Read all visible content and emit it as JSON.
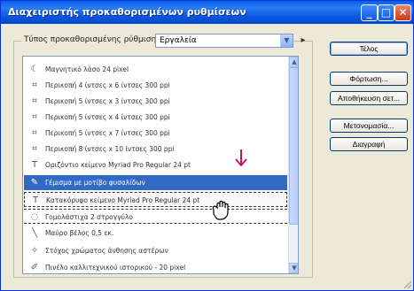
{
  "window": {
    "title": "Διαχειριστής προκαθορισμένων ρυθμίσεων",
    "min_label": "_",
    "max_label": "□",
    "close_label": "✕"
  },
  "preset": {
    "label": "Τύπος προκαθορισμένης ρύθμισης:",
    "selected": "Εργαλεία",
    "menu_icon": "▸"
  },
  "list": {
    "items": [
      {
        "icon": "magnetic-lasso-icon",
        "glyph": "☾",
        "label": "Μαγνητικό λάσο 24 pixel"
      },
      {
        "icon": "crop-icon",
        "glyph": "⌗",
        "label": "Περικοπή 4 ίντσες x 6 ίντσες 300 ppi"
      },
      {
        "icon": "crop-icon",
        "glyph": "⌗",
        "label": "Περικοπή 5 ίντσες x 3 ίντσες 300 ppi"
      },
      {
        "icon": "crop-icon",
        "glyph": "⌗",
        "label": "Περικοπή 5 ίντσες x 4 ίντσες 300 ppi"
      },
      {
        "icon": "crop-icon",
        "glyph": "⌗",
        "label": "Περικοπή 5 ίντσες x 7 ίντσες 300 ppi"
      },
      {
        "icon": "crop-icon",
        "glyph": "⌗",
        "label": "Περικοπή 8 ίντσες x 10 ίντσες 300 ppi"
      },
      {
        "icon": "type-icon",
        "glyph": "T",
        "label": "Οριζόντιο κείμενο Myriad Pro Regular 24 pt"
      },
      {
        "icon": "brush-icon",
        "glyph": "✎",
        "label": "Γέμισμα με μοτίβο φυσαλίδων"
      },
      {
        "icon": "type-icon",
        "glyph": "T",
        "label": "Κατακόρυφο κείμενο Myriad Pro Regular 24 pt"
      },
      {
        "icon": "eraser-icon",
        "glyph": "◌",
        "label": "Γομολάστιχα 2 στρογγύλο"
      },
      {
        "icon": "pencil-icon",
        "glyph": "╲",
        "label": "Μαύρο βέλος 0,5 εκ."
      },
      {
        "icon": "star-icon",
        "glyph": "✧",
        "label": "Στόχος χρώματος άνθησης αστέρων"
      },
      {
        "icon": "history-brush-icon",
        "glyph": "✐",
        "label": "Πινέλο καλλιτεχνικού ιστορικού - 20 pixel"
      }
    ],
    "selected_index": 7,
    "scroll_up": "▲",
    "scroll_down": "▼"
  },
  "buttons": {
    "done": "Τέλος",
    "load": "Φόρτωση...",
    "save_set": "Αποθήκευση σετ...",
    "rename": "Μετονομασία...",
    "delete": "Διαγραφή"
  },
  "colors": {
    "title_bar": "#0a56e0",
    "selection": "#316ac5",
    "drop_arrow": "#c2185b"
  }
}
